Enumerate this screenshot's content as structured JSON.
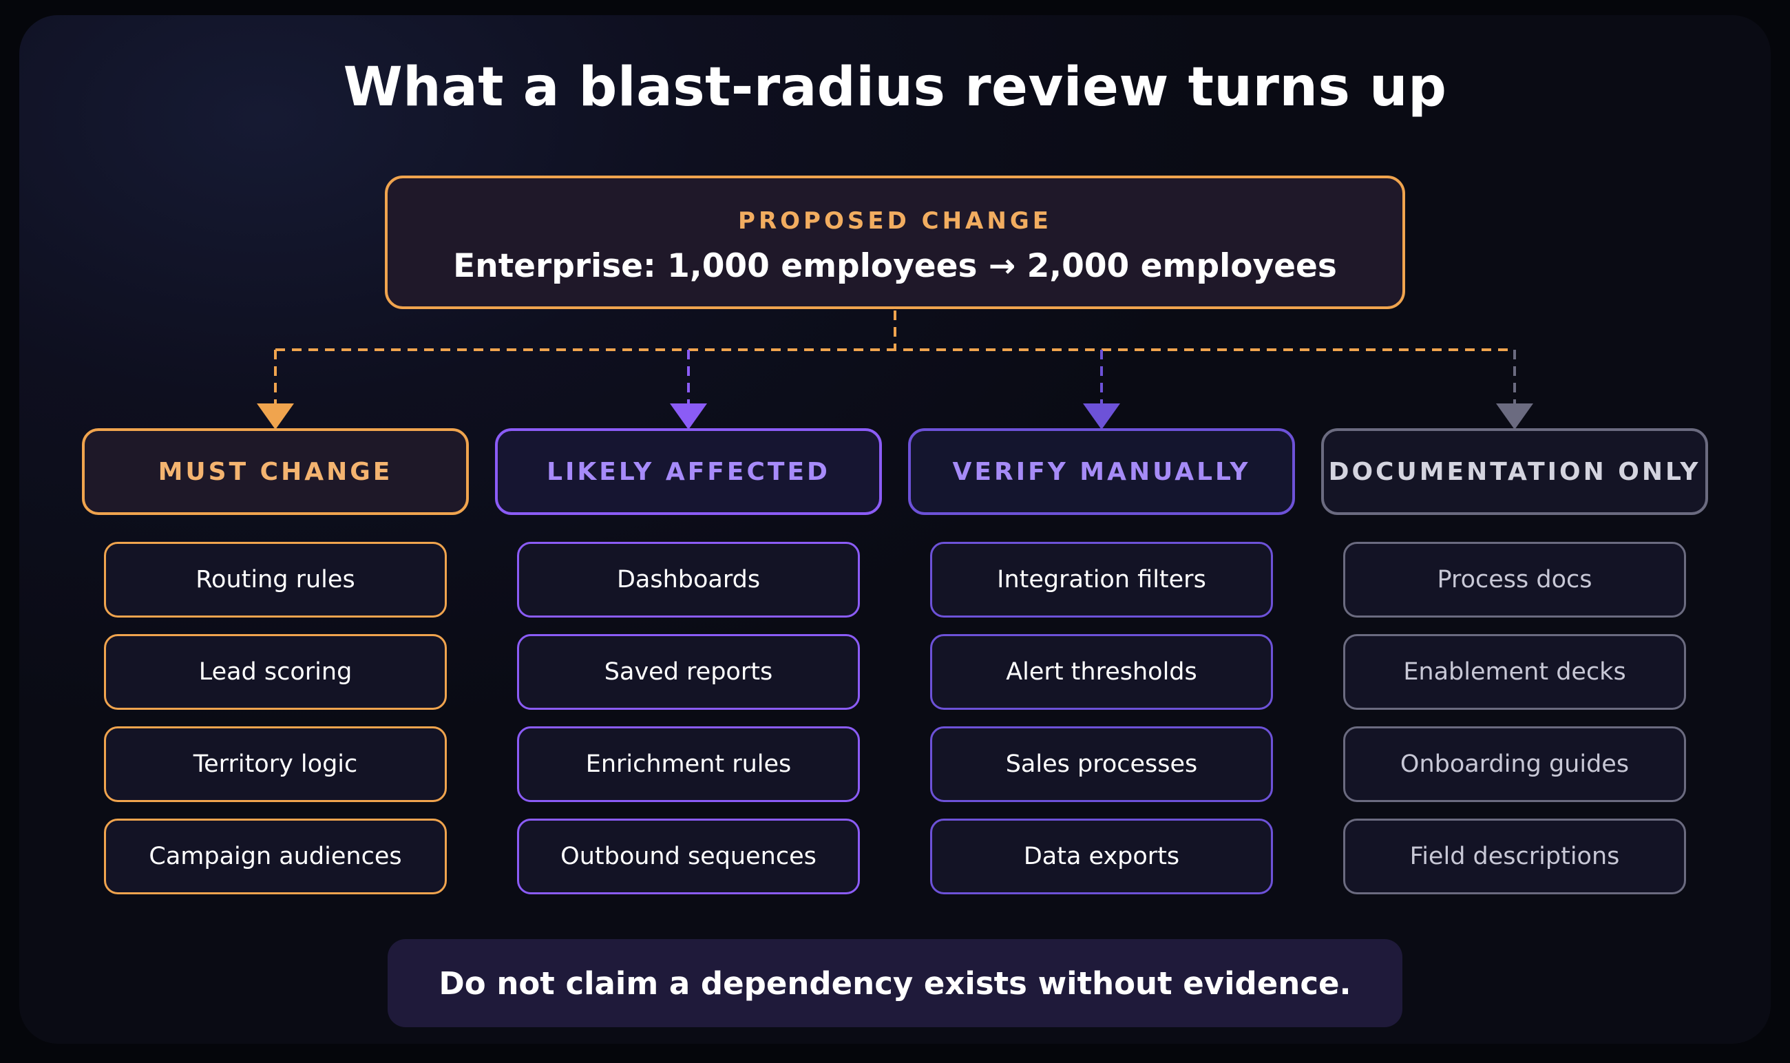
{
  "title": "What a blast-radius review turns up",
  "proposed_change": {
    "label": "PROPOSED CHANGE",
    "value": "Enterprise: 1,000 employees → 2,000 employees"
  },
  "categories": [
    {
      "name": "MUST CHANGE",
      "color": "#f0a44e",
      "header_bg": "#1e1828",
      "header_text_color": "#f4b470",
      "item_text_color": "#ffffff",
      "items": [
        "Routing rules",
        "Lead scoring",
        "Territory logic",
        "Campaign audiences"
      ]
    },
    {
      "name": "LIKELY AFFECTED",
      "color": "#8b5cf6",
      "header_bg": "#161531",
      "header_text_color": "#a78bfa",
      "item_text_color": "#ffffff",
      "items": [
        "Dashboards",
        "Saved reports",
        "Enrichment rules",
        "Outbound sequences"
      ]
    },
    {
      "name": "VERIFY MANUALLY",
      "color": "#6d52d8",
      "header_bg": "#14152e",
      "header_text_color": "#a68bf7",
      "item_text_color": "#ffffff",
      "items": [
        "Integration filters",
        "Alert thresholds",
        "Sales processes",
        "Data exports"
      ]
    },
    {
      "name": "DOCUMENTATION ONLY",
      "color": "#6b6b80",
      "header_bg": "#141425",
      "header_text_color": "#d4d4df",
      "item_text_color": "#c8c8d6",
      "items": [
        "Process docs",
        "Enablement decks",
        "Onboarding guides",
        "Field descriptions"
      ]
    }
  ],
  "footer_note": "Do not claim a dependency exists without evidence."
}
